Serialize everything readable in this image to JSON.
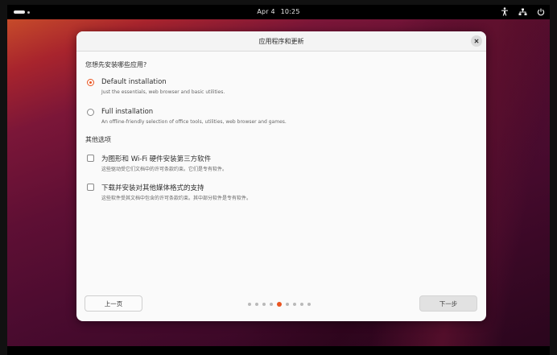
{
  "topbar": {
    "date": "Apr 4",
    "time": "10:25",
    "tray_icons": [
      "accessibility-icon",
      "network-icon",
      "power-icon"
    ]
  },
  "dialog": {
    "title": "应用程序和更新",
    "close_icon": "close-icon",
    "section1_heading": "您想先安装哪些应用?",
    "options": [
      {
        "label": "Default installation",
        "description": "Just the essentials, web browser and basic utilities.",
        "selected": true
      },
      {
        "label": "Full installation",
        "description": "An offline-friendly selection of office tools, utilities, web browser and games.",
        "selected": false
      }
    ],
    "section2_heading": "其他选项",
    "checkboxes": [
      {
        "label": "为图形和 Wi-Fi 硬件安装第三方软件",
        "description": "这些驱动受它们文档中的许可条款约束。它们是专有软件。",
        "checked": false
      },
      {
        "label": "下载并安装对其他媒体格式的支持",
        "description": "这些软件受其文档中包含的许可条款约束。其中部分软件是专有软件。",
        "checked": false
      }
    ],
    "back_label": "上一页",
    "next_label": "下一步",
    "pager": {
      "total": 9,
      "current": 5
    }
  },
  "colors": {
    "accent": "#e95420"
  }
}
